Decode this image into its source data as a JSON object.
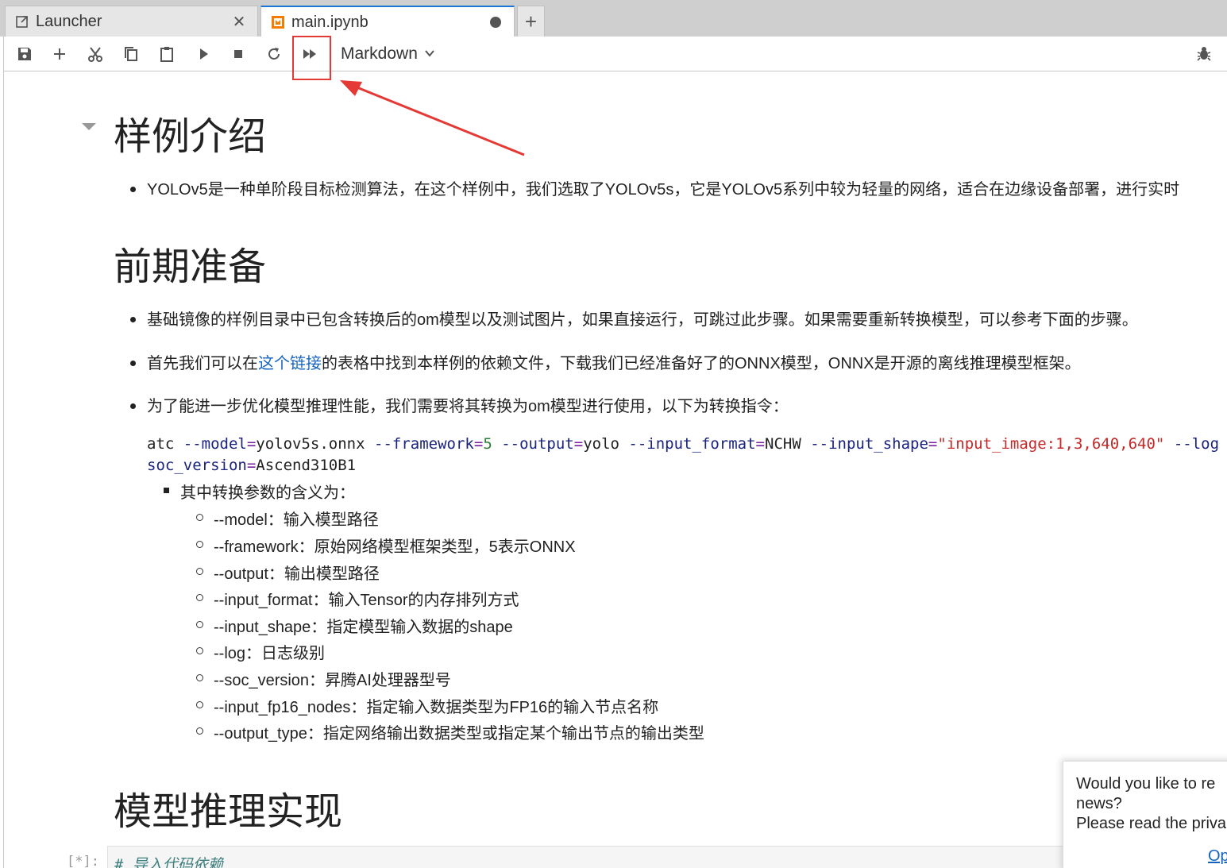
{
  "tabs": [
    {
      "label": "Launcher",
      "icon": "launcher-icon"
    },
    {
      "label": "main.ipynb",
      "icon": "notebook-icon",
      "modified": true
    }
  ],
  "toolbar": {
    "buttons": [
      "save",
      "insert-cell",
      "cut",
      "copy",
      "paste",
      "run",
      "stop",
      "restart",
      "restart-run-all"
    ],
    "cell_type": "Markdown"
  },
  "notebook": {
    "h1": "样例介绍",
    "intro": "YOLOv5是一种单阶段目标检测算法，在这个样例中，我们选取了YOLOv5s，它是YOLOv5系列中较为轻量的网络，适合在边缘设备部署，进行实时",
    "h2": "前期准备",
    "prep_1": "基础镜像的样例目录中已包含转换后的om模型以及测试图片，如果直接运行，可跳过此步骤。如果需要重新转换模型，可以参考下面的步骤。",
    "prep_2_pre": "首先我们可以在",
    "prep_2_link": "这个链接",
    "prep_2_post": "的表格中找到本样例的依赖文件，下载我们已经准备好了的ONNX模型，ONNX是开源的离线推理模型框架。",
    "prep_3": "为了能进一步优化模型推理性能，我们需要将其转换为om模型进行使用，以下为转换指令：",
    "cmd": {
      "c1": "atc ",
      "c2": "--model",
      "c3": "=",
      "c4": "yolov5s.onnx ",
      "c5": "--framework",
      "c6": "=",
      "c7": "5",
      "c8": " ",
      "c9": "--output",
      "c10": "=",
      "c11": "yolo ",
      "c12": "--input_format",
      "c13": "=",
      "c14": "NCHW ",
      "c15": "--input_shape",
      "c16": "=",
      "c17": "\"input_image:1,3,640,640\"",
      "c18": " ",
      "c19": "--log",
      "d1": "soc_version",
      "d2": "=",
      "d3": "Ascend310B1"
    },
    "params_title": "其中转换参数的含义为：",
    "params": [
      "--model：输入模型路径",
      "--framework：原始网络模型框架类型，5表示ONNX",
      "--output：输出模型路径",
      "--input_format：输入Tensor的内存排列方式",
      "--input_shape：指定模型输入数据的shape",
      "--log：日志级别",
      "--soc_version：昇腾AI处理器型号",
      "--input_fp16_nodes：指定输入数据类型为FP16的输入节点名称",
      "--output_type：指定网络输出数据类型或指定某个输出节点的输出类型"
    ],
    "h3": "模型推理实现",
    "code_prompt": "[*]:",
    "code_comment": "# 导入代码依赖"
  },
  "notification": {
    "line1": "Would you like to re",
    "line2": "news?",
    "line3": "Please read the priva",
    "button": "Op"
  },
  "colors": {
    "accent": "#1976d2",
    "highlight": "#e53935",
    "link": "#1565c0"
  }
}
